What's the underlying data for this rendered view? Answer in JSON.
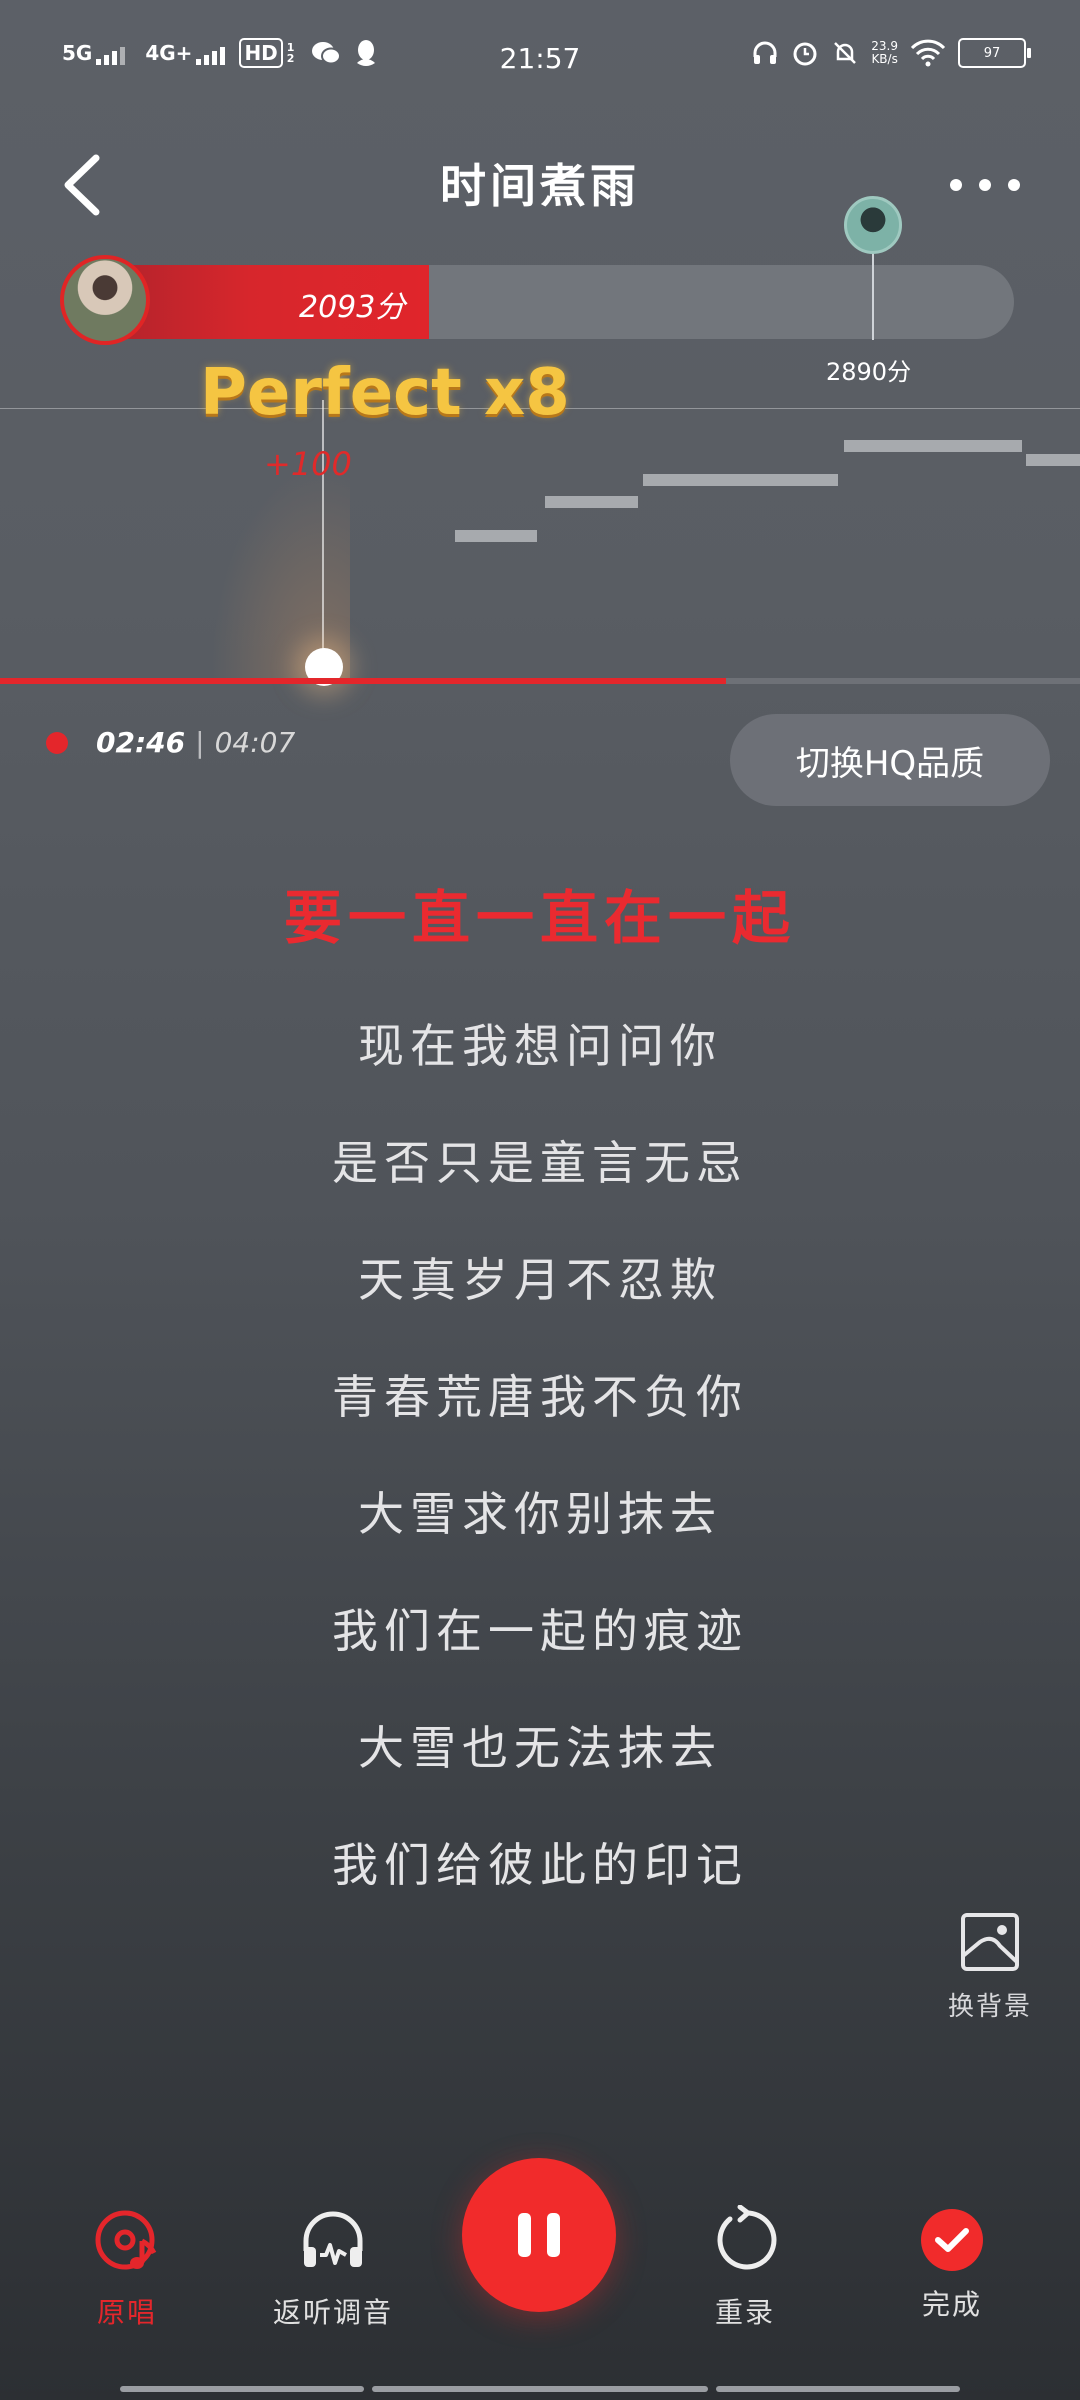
{
  "status_bar": {
    "net1": "5G",
    "net2": "4G+",
    "hd": "HD",
    "hd_sub": "1 2",
    "time": "21:57",
    "speed": "23.9",
    "speed_unit": "KB/s",
    "battery": "97"
  },
  "header": {
    "title": "时间煮雨"
  },
  "score": {
    "my_score": "2093分",
    "target_score": "2890分",
    "my_progress": 0.38,
    "target_progress": 0.85
  },
  "judgement": {
    "perfect": "Perfect x8",
    "bonus": "+100"
  },
  "playback": {
    "current": "02:46",
    "separator": "|",
    "total": "04:07",
    "progress": 0.672
  },
  "hq_button": "切换HQ品质",
  "lyrics": {
    "active": "要一直一直在一起",
    "lines": [
      "现在我想问问你",
      "是否只是童言无忌",
      "天真岁月不忍欺",
      "青春荒唐我不负你",
      "大雪求你别抹去",
      "我们在一起的痕迹",
      "大雪也无法抹去",
      "我们给彼此的印记"
    ]
  },
  "change_bg": "换背景",
  "bottom_nav": {
    "original": "原唱",
    "ear_monitor": "返听调音",
    "rerecord": "重录",
    "done": "完成"
  },
  "icons": {
    "back": "chevron-left-icon",
    "more": "more-dots-icon",
    "pause": "pause-icon",
    "original": "original-vocal-icon",
    "ear": "headphone-icon",
    "rerecord": "rerecord-icon",
    "done": "check-icon",
    "change_bg": "image-icon"
  },
  "colors": {
    "accent": "#e4262b",
    "perfect": "#f5c542"
  }
}
